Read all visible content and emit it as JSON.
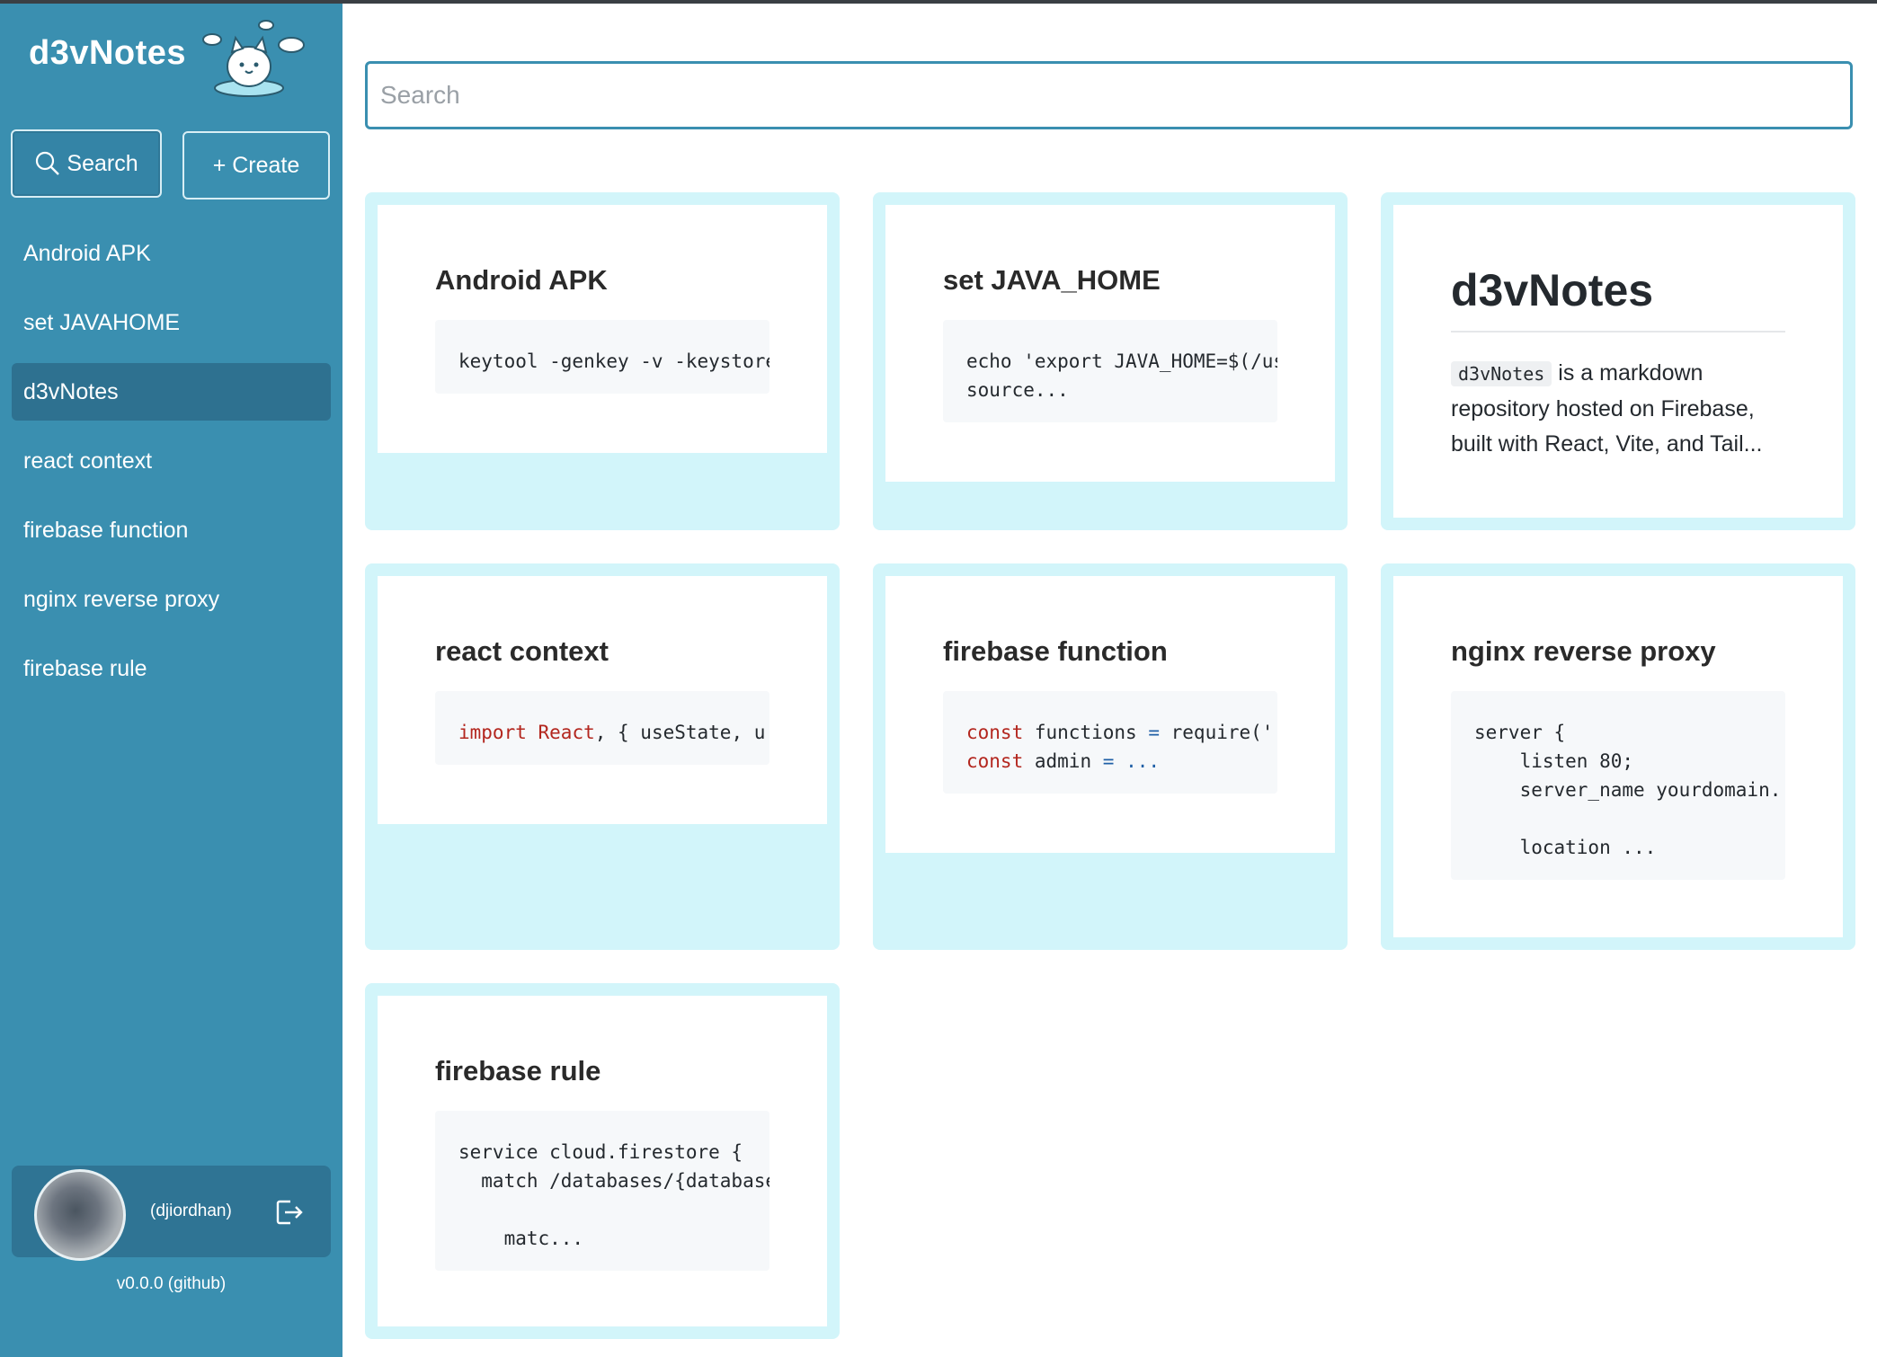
{
  "app": {
    "name": "d3vNotes",
    "version_label": "v0.0.0 (github)"
  },
  "sidebar": {
    "search_label": "Search",
    "create_label": "+ Create",
    "items": [
      {
        "label": "Android APK"
      },
      {
        "label": "set JAVAHOME"
      },
      {
        "label": "d3vNotes",
        "active": true
      },
      {
        "label": "react context"
      },
      {
        "label": "firebase function"
      },
      {
        "label": "nginx reverse proxy"
      },
      {
        "label": "firebase rule"
      }
    ],
    "user": {
      "username": "(djiordhan)"
    }
  },
  "search": {
    "placeholder": "Search"
  },
  "notes": [
    {
      "title": "Android APK",
      "code": [
        "keytool -genkey -v -keystore"
      ]
    },
    {
      "title": "set JAVA_HOME",
      "code": [
        "echo 'export JAVA_HOME=$(/us",
        "source..."
      ]
    },
    {
      "title": "d3vNotes",
      "inline_code": "d3vNotes",
      "text": "is a markdown repository hosted on Firebase, built with React, Vite, and Tail..."
    },
    {
      "title": "react context",
      "code_kw": "import",
      "code_kw2": "React",
      "code_rest": ", { useState, u"
    },
    {
      "title": "firebase function",
      "line1_kw": "const",
      "line1_name": "functions",
      "line1_eq": "=",
      "line1_rest": "require('",
      "line2_kw": "const",
      "line2_name": "admin",
      "line2_eq": "=",
      "line2_rest": "..."
    },
    {
      "title": "nginx reverse proxy",
      "code": [
        "server {",
        "    listen 80;",
        "    server_name yourdomain.",
        "",
        "    location ..."
      ]
    },
    {
      "title": "firebase rule",
      "code": [
        "service cloud.firestore {",
        "  match /databases/{database",
        "",
        "    matc..."
      ]
    }
  ],
  "colors": {
    "sidebar_bg": "#3a8fb0",
    "active_item": "#2e7190",
    "card_border": "#d2f5fa",
    "keyword": "#b3261e"
  }
}
